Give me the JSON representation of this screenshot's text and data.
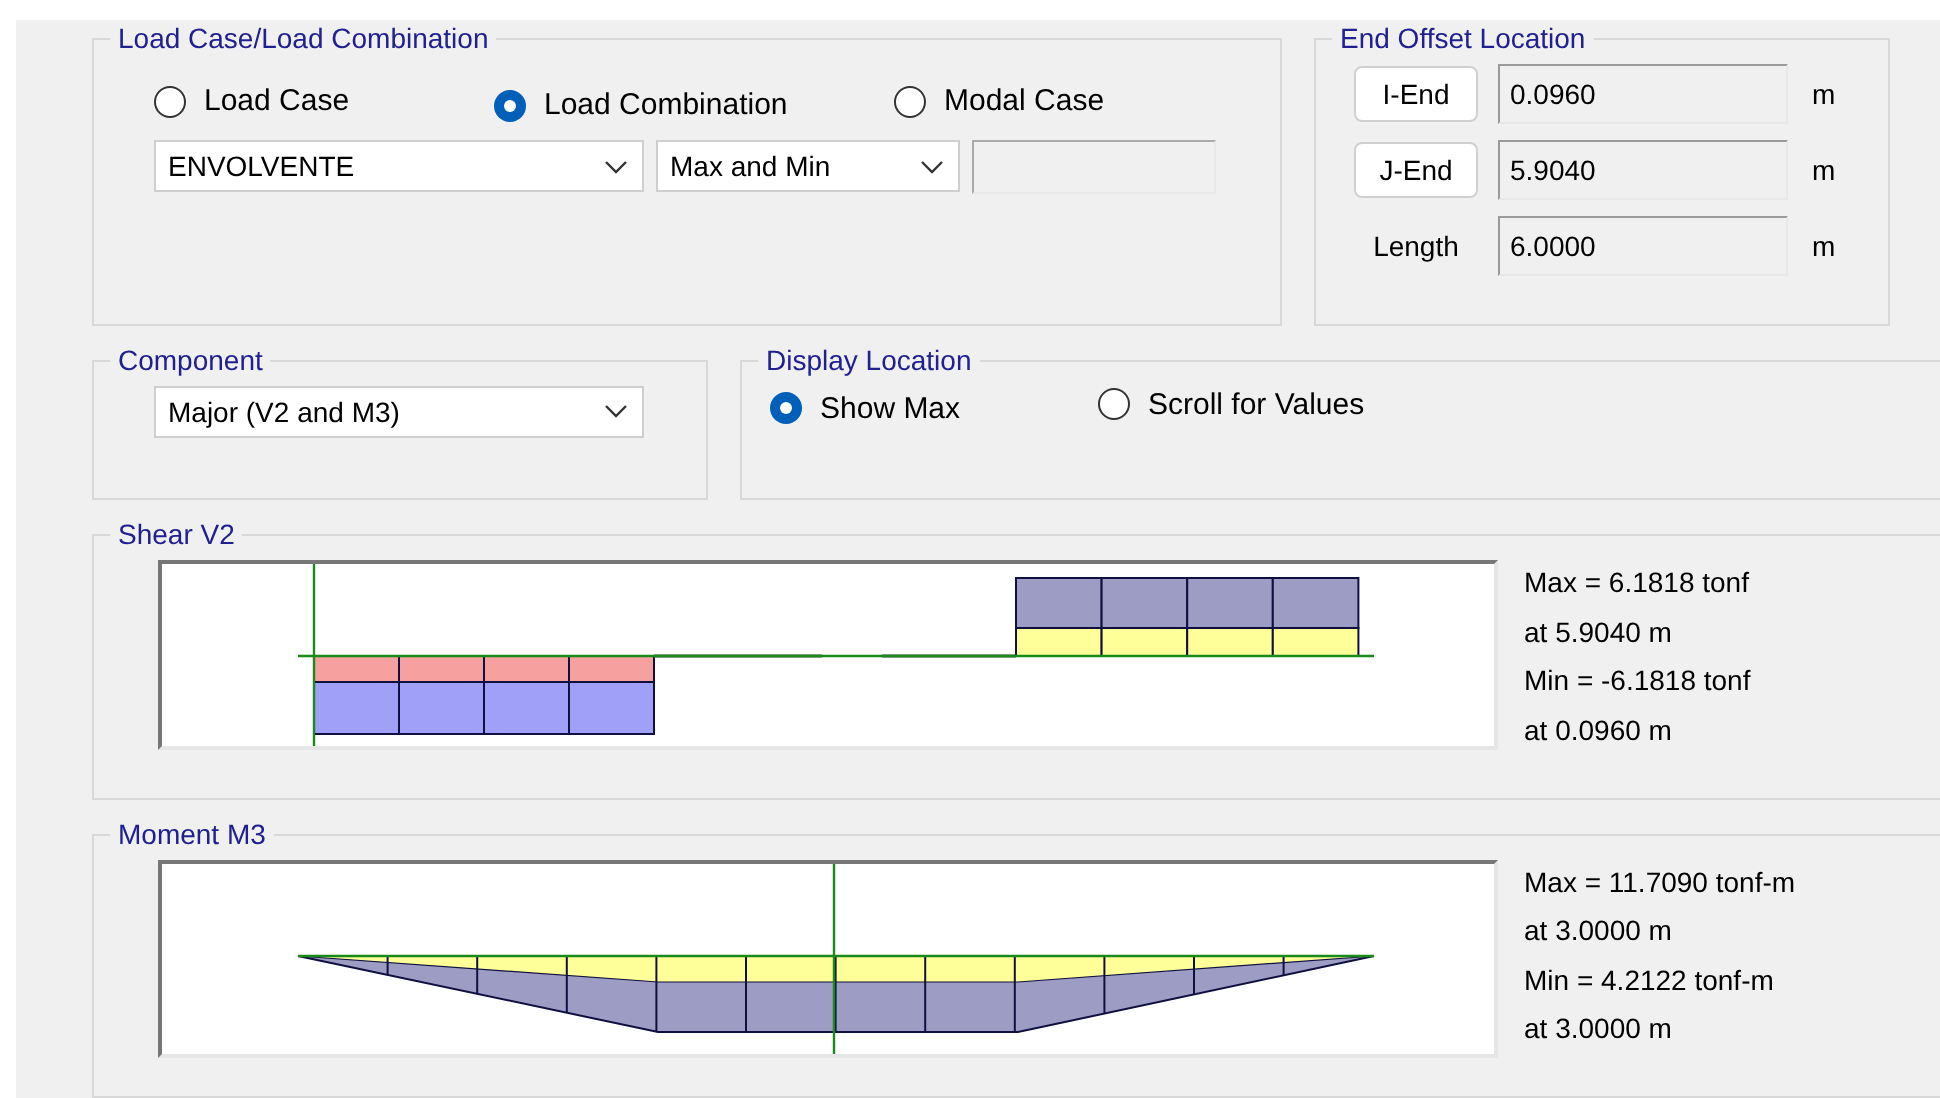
{
  "load_case": {
    "title": "Load Case/Load Combination",
    "options": [
      {
        "label": "Load Case",
        "selected": false
      },
      {
        "label": "Load Combination",
        "selected": true
      },
      {
        "label": "Modal Case",
        "selected": false
      }
    ],
    "combination": "ENVOLVENTE",
    "envelope": "Max and Min"
  },
  "end_offset": {
    "title": "End Offset Location",
    "rows": [
      {
        "kind": "button",
        "label": "I-End",
        "value": "0.0960",
        "unit": "m"
      },
      {
        "kind": "button",
        "label": "J-End",
        "value": "5.9040",
        "unit": "m"
      },
      {
        "kind": "label",
        "label": "Length",
        "value": "6.0000",
        "unit": "m"
      }
    ]
  },
  "component": {
    "title": "Component",
    "value": "Major (V2 and M3)"
  },
  "display_location": {
    "title": "Display Location",
    "options": [
      {
        "label": "Show Max",
        "selected": true
      },
      {
        "label": "Scroll for Values",
        "selected": false
      }
    ]
  },
  "diagrams": [
    {
      "kind": "shear",
      "title": "Shear V2",
      "results": [
        "Max = 6.1818 tonf",
        "at 5.9040 m",
        "Min = -6.1818 tonf",
        "at 0.0960 m"
      ]
    },
    {
      "kind": "moment",
      "title": "Moment M3",
      "results": [
        "Max = 11.7090 tonf-m",
        "at 3.0000 m",
        "Min = 4.2122 tonf-m",
        "at 3.0000 m"
      ]
    }
  ]
}
